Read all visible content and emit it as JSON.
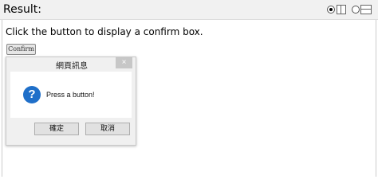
{
  "result_bar": {
    "title": "Result:"
  },
  "main": {
    "instruction": "Click the button to display a confirm box.",
    "confirm_button_label": "Confirm"
  },
  "dialog": {
    "title": "網頁訊息",
    "close_glyph": "×",
    "message": "Press a button!",
    "ok_label": "確定",
    "cancel_label": "取消",
    "icon_glyph": "?"
  }
}
